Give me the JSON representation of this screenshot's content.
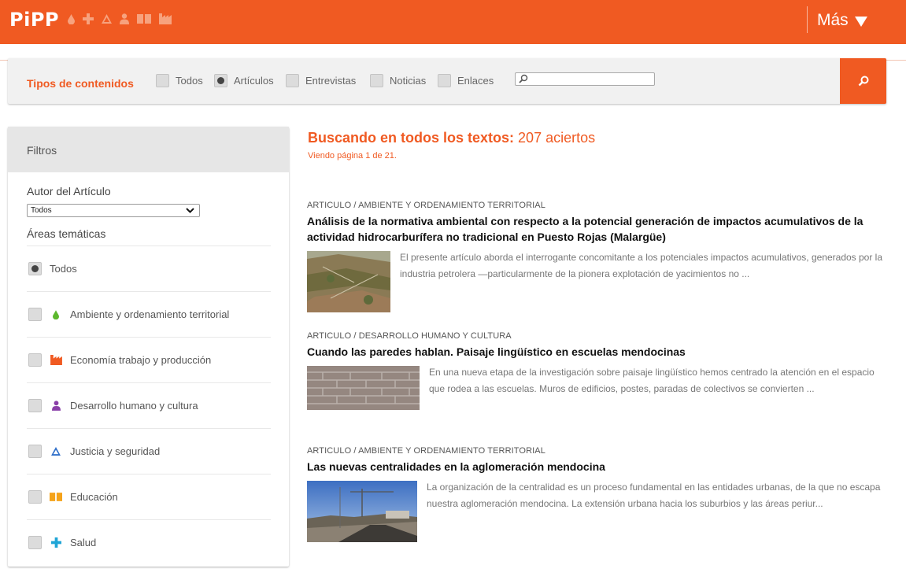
{
  "header": {
    "logo": "PiPP",
    "logo_icons": [
      "drop-icon",
      "cross-icon",
      "triangle-drop-icon",
      "person-icon",
      "book-icon",
      "factory-icon"
    ],
    "more_label": "Más"
  },
  "type_bar": {
    "label": "Tipos de contenidos",
    "options": [
      {
        "label": "Todos",
        "checked": false
      },
      {
        "label": "Artículos",
        "checked": true
      },
      {
        "label": "Entrevistas",
        "checked": false
      },
      {
        "label": "Noticias",
        "checked": false
      },
      {
        "label": "Enlaces",
        "checked": false
      }
    ],
    "search_value": "",
    "search_button_icon": "search-icon"
  },
  "filters": {
    "title": "Filtros",
    "author_label": "Autor del Artículo",
    "author_selected": "Todos",
    "areas_label": "Áreas temáticas",
    "areas": [
      {
        "label": "Todos",
        "checked": true,
        "icon": null,
        "color": null
      },
      {
        "label": "Ambiente y ordenamiento territorial",
        "checked": false,
        "icon": "drop-icon",
        "color": "#5cb82e"
      },
      {
        "label": "Economía trabajo y producción",
        "checked": false,
        "icon": "factory-icon",
        "color": "#f05a22"
      },
      {
        "label": "Desarrollo humano y cultura",
        "checked": false,
        "icon": "person-icon",
        "color": "#8a3fa8"
      },
      {
        "label": "Justicia y seguridad",
        "checked": false,
        "icon": "triangle-drop-icon",
        "color": "#2f6fc9"
      },
      {
        "label": "Educación",
        "checked": false,
        "icon": "book-icon",
        "color": "#f5a31a"
      },
      {
        "label": "Salud",
        "checked": false,
        "icon": "cross-icon",
        "color": "#20a5d6"
      }
    ]
  },
  "results": {
    "title_bold": "Buscando en todos los textos:",
    "title_count": "207 aciertos",
    "subtitle": "Viendo página 1 de 21.",
    "articles": [
      {
        "type": "ARTICULO",
        "category": "AMBIENTE Y ORDENAMIENTO TERRITORIAL",
        "title": "Análisis de la normativa ambiental con respecto a la potencial generación de impactos acumulativos de la actividad hidrocarburífera no tradicional en Puesto Rojas (Malargüe)",
        "excerpt": "El presente artículo aborda el interrogante concomitante a los potenciales impactos acumulativos, generados por la industria petrolera —particularmente de la pionera explotación de yacimientos no ..."
      },
      {
        "type": "ARTICULO",
        "category": "DESARROLLO HUMANO Y CULTURA",
        "title": "Cuando las paredes hablan. Paisaje lingüístico en escuelas mendocinas",
        "excerpt": "En una nueva etapa de la investigación sobre paisaje lingüístico hemos centrado la atención en el espacio que rodea a las escuelas. Muros de edificios, postes, paradas de colectivos se convierten ..."
      },
      {
        "type": "ARTICULO",
        "category": "AMBIENTE Y ORDENAMIENTO TERRITORIAL",
        "title": "Las nuevas centralidades en la aglomeración mendocina",
        "excerpt": "La organización de la centralidad es un proceso fundamental en las entidades urbanas, de la que no escapa nuestra aglomeración mendocina. La extensión urbana hacia los suburbios y las áreas periur..."
      }
    ]
  }
}
